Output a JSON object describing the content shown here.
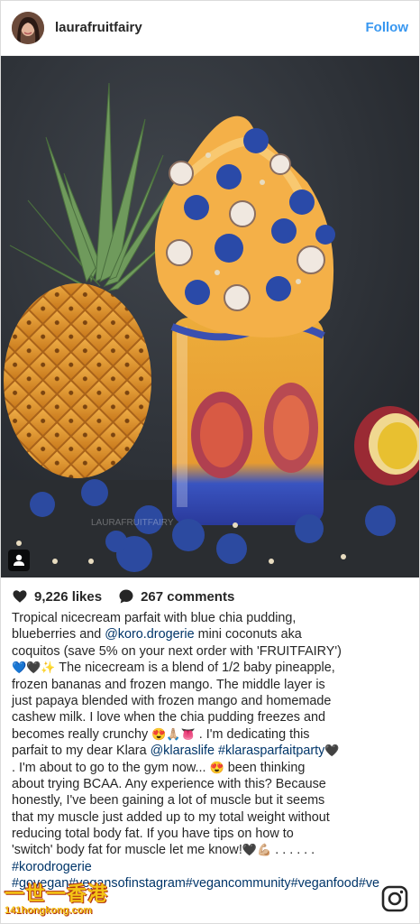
{
  "header": {
    "username": "laurafruitfairy",
    "follow_label": "Follow"
  },
  "post": {
    "likes": "9,226 likes",
    "comments": "267 comments",
    "photo_watermark": "LAURAFRUITFAIRY",
    "caption_lines": [
      {
        "parts": [
          {
            "t": "Tropical nicecream parfait with blue chia pudding,"
          }
        ]
      },
      {
        "parts": [
          {
            "t": "blueberries and "
          },
          {
            "t": "@koro.drogerie",
            "link": true
          },
          {
            "t": " mini coconuts aka"
          }
        ]
      },
      {
        "parts": [
          {
            "t": "coquitos (save 5% on your next order with 'FRUITFAIRY')"
          }
        ]
      },
      {
        "parts": [
          {
            "t": "💙🖤✨",
            "emoji": true
          },
          {
            "t": " The nicecream is a blend of 1/2 baby pineapple,"
          }
        ]
      },
      {
        "parts": [
          {
            "t": "frozen bananas and frozen mango. The middle layer is"
          }
        ]
      },
      {
        "parts": [
          {
            "t": "just papaya blended with frozen mango and homemade"
          }
        ]
      },
      {
        "parts": [
          {
            "t": "cashew milk. I love when the chia pudding freezes and"
          }
        ]
      },
      {
        "parts": [
          {
            "t": "becomes really crunchy "
          },
          {
            "t": "😍🙏🏼👅",
            "emoji": true
          },
          {
            "t": " . I'm dedicating this"
          }
        ]
      },
      {
        "parts": [
          {
            "t": "parfait to my dear Klara "
          },
          {
            "t": "@klaraslife",
            "link": true
          },
          {
            "t": " "
          },
          {
            "t": "#klarasparfaitparty",
            "link": true
          },
          {
            "t": " 🖤",
            "emoji": true
          }
        ]
      },
      {
        "parts": [
          {
            "t": ". I'm about to go to the gym now... "
          },
          {
            "t": "😍",
            "emoji": true
          },
          {
            "t": " been thinking"
          }
        ]
      },
      {
        "parts": [
          {
            "t": "about trying BCAA. Any experience with this? Because"
          }
        ]
      },
      {
        "parts": [
          {
            "t": "honestly, I've been gaining a lot of muscle but it seems"
          }
        ]
      },
      {
        "parts": [
          {
            "t": "that my muscle just added up to my total weight without"
          }
        ]
      },
      {
        "parts": [
          {
            "t": "reducing total body fat. If you have tips on how to"
          }
        ]
      },
      {
        "parts": [
          {
            "t": "'switch' body fat for muscle let me know!"
          },
          {
            "t": "🖤💪🏼",
            "emoji": true
          },
          {
            "t": " . . . . . ."
          }
        ]
      },
      {
        "parts": [
          {
            "t": "#korodrogerie",
            "link": true
          }
        ]
      },
      {
        "parts": [
          {
            "t": "#govegan#vegansofinstagram#vegancommunity#veganfood#ve",
            "link": true
          }
        ]
      }
    ]
  },
  "watermark": {
    "line1": "一世一香港",
    "line2": "141hongkong.com"
  },
  "colors": {
    "accent": "#3897f0",
    "link": "#003569",
    "text": "#262626"
  },
  "icons": [
    "heart-icon",
    "comment-icon",
    "user-tag-icon",
    "instagram-logo-icon"
  ]
}
